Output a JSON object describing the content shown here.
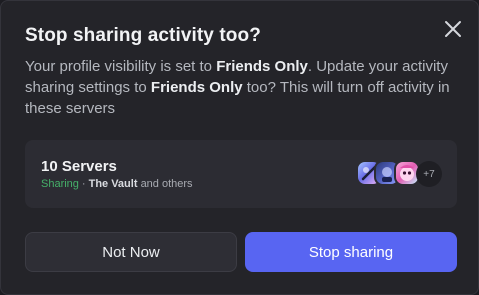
{
  "modal": {
    "title": "Stop sharing activity too?",
    "description": {
      "part1": "Your profile visibility is set to ",
      "bold1": "Friends Only",
      "part2": ". Update your activity sharing settings to ",
      "bold2": "Friends Only",
      "part3": " too? This will turn off activity in these servers"
    }
  },
  "server_card": {
    "count_label": "10 Servers",
    "sharing_label": "Sharing",
    "separator": "·",
    "server_name": "The Vault",
    "others_label": "and others",
    "more_count": "+7"
  },
  "buttons": {
    "secondary_label": "Not Now",
    "primary_label": "Stop sharing"
  },
  "colors": {
    "background": "#242429",
    "card": "#2c2c33",
    "primary_button": "#5865f2",
    "sharing_green": "#45b069"
  },
  "icons": {
    "close": "close-icon"
  }
}
